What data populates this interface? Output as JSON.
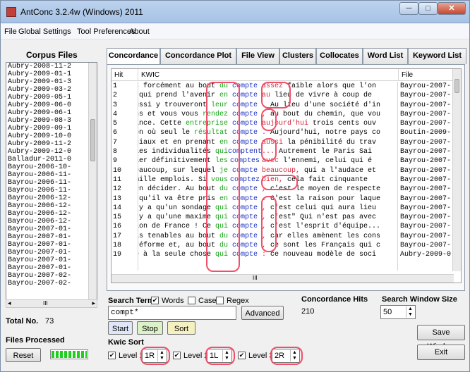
{
  "window": {
    "title": "AntConc 3.2.4w (Windows) 2011",
    "minimize": "─",
    "maximize": "□",
    "close": "✕"
  },
  "menu": [
    "File",
    "Global Settings",
    "Tool Preferences",
    "About"
  ],
  "sidebar": {
    "title": "Corpus Files",
    "files": [
      "Aubry-2008-11-2",
      "Aubry-2009-01-1",
      "Aubry-2009-01-3",
      "Aubry-2009-03-2",
      "Aubry-2009-05-1",
      "Aubry-2009-06-0",
      "Aubry-2009-06-1",
      "Aubry-2009-08-3",
      "Aubry-2009-09-1",
      "Aubry-2009-10-0",
      "Aubry-2009-11-2",
      "Aubry-2009-12-0",
      "Balladur-2011-0",
      "Bayrou-2006-10-",
      "Bayrou-2006-11-",
      "Bayrou-2006-11-",
      "Bayrou-2006-11-",
      "Bayrou-2006-12-",
      "Bayrou-2006-12-",
      "Bayrou-2006-12-",
      "Bayrou-2006-12-",
      "Bayrou-2007-01-",
      "Bayrou-2007-01-",
      "Bayrou-2007-01-",
      "Bayrou-2007-01-",
      "Bayrou-2007-01-",
      "Bayrou-2007-01-",
      "Bayrou-2007-02-",
      "Bayrou-2007-02-"
    ],
    "scroll_left": "◂",
    "scroll_mid": "III",
    "scroll_right": "▸",
    "total_label": "Total No.",
    "total_value": "73",
    "processed_label": "Files Processed",
    "reset_label": "Reset",
    "progress": 1.0
  },
  "tabs": [
    "Concordance",
    "Concordance Plot",
    "File View",
    "Clusters",
    "Collocates",
    "Word List",
    "Keyword List"
  ],
  "concordance": {
    "headers": {
      "hit": "Hit",
      "kwic": "KWIC",
      "file": "File"
    },
    "rows": [
      {
        "hit": "1",
        "left": "eurs forcément au bout ",
        "leftc": "du",
        "leftcol": "green",
        "kw": "compte",
        "rw": "assez",
        "rwcol": "red",
        "rrest": " faible alors que l'on",
        "file": "Bayrou-2007-"
      },
      {
        "hit": "2",
        "left": "re, qui prend l'avenir ",
        "leftc": "en",
        "leftcol": "green",
        "kw": "compte",
        "rw": "au",
        "rwcol": "red",
        "rrest": " lieu de vivre à coup de",
        "file": "Bayrou-2007-"
      },
      {
        "hit": "3",
        "left": "s aussi y trouveront ",
        "leftc": "leur",
        "leftcol": "green",
        "kw": "compte",
        "rw": ".",
        "rwcol": "red",
        "rrest": " Au lieu d'une société d'in",
        "file": "Bayrou-2007-"
      },
      {
        "hit": "4",
        "left": "tions et vous vous ",
        "leftc": "rendez",
        "leftcol": "green",
        "kw": "compte",
        "rw": ",",
        "rwcol": "red",
        "rrest": " au bout du chemin, que vou",
        "file": "Bayrou-2007-"
      },
      {
        "hit": "5",
        "left": " France. Cette ",
        "leftc": "entreprise",
        "leftcol": "green",
        "kw": "compte",
        "rw": "aujourd'hui",
        "rwcol": "red",
        "rrest": " trois cents ouv",
        "file": "Bayrou-2007-"
      },
      {
        "hit": "6",
        "left": "ition où seul le ",
        "leftc": "résultat",
        "leftcol": "green",
        "kw": "compte",
        "rw": ".",
        "rwcol": "red",
        "rrest": " Aujourd'hui, notre pays co",
        "file": "Boutin-2009-"
      },
      {
        "hit": "7",
        "left": "spéciaux et en prenant ",
        "leftc": "en",
        "leftcol": "green",
        "kw": "compte",
        "rw": "aussi",
        "rwcol": "red",
        "rrest": " la pénibilité du trav",
        "file": "Bayrou-2007-"
      },
      {
        "hit": "8",
        "left": "as les individualités ",
        "leftc": "qui",
        "leftcol": "green",
        "kw": "comptent",
        "rw": "...",
        "rwcol": "red",
        "rrest": " Autrement le Paris Sai",
        "file": "Bayrou-2007-"
      },
      {
        "hit": "9",
        "left": "régler définitivement ",
        "leftc": "les",
        "leftcol": "green",
        "kw": "comptes",
        "rw": "avec",
        "rwcol": "red",
        "rrest": " l'ennemi, celui qui é",
        "file": "Bayrou-2007-"
      },
      {
        "hit": "10",
        "left": "e beaucoup, sur lequel ",
        "leftc": "je",
        "leftcol": "green",
        "kw": "compte",
        "rw": "beaucoup,",
        "rwcol": "red",
        "rrest": " qui a l'audace et",
        "file": "Bayrou-2007-"
      },
      {
        "hit": "11",
        "left": "ts mille emplois. Si ",
        "leftc": "vous",
        "leftcol": "green",
        "kw": "comptez",
        "rw": "bien,",
        "rwcol": "red",
        "rrest": " cela fait cinquante",
        "file": "Bayrou-2007-"
      },
      {
        "hit": "12",
        "left": "nt en décider. Au bout ",
        "leftc": "du",
        "leftcol": "green",
        "kw": "compte",
        "rw": ",",
        "rwcol": "red",
        "rrest": " c'est le moyen de respecte",
        "file": "Bayrou-2007-"
      },
      {
        "hit": "13",
        "left": "ude qu'il va être pris ",
        "leftc": "en",
        "leftcol": "green",
        "kw": "compte",
        "rw": ".",
        "rwcol": "red",
        "rrest": " C'est la raison pour laque",
        "file": "Bayrou-2007-"
      },
      {
        "hit": "14",
        "left": "l n'y a qu'un sondage ",
        "leftc": "qui",
        "leftcol": "green",
        "kw": "compte",
        "rw": ",",
        "rwcol": "red",
        "rrest": " c'est celui qui aura lieu",
        "file": "Bayrou-2007-"
      },
      {
        "hit": "15",
        "left": "l n'y a qu'une maxime ",
        "leftc": "qui",
        "leftcol": "green",
        "kw": "compte",
        "rw": ",",
        "rwcol": "red",
        "rrest": " c'est\" Qui n'est pas avec",
        "file": "Bayrou-2007-"
      },
      {
        "hit": "16",
        "left": "ampion de France ! Ce ",
        "leftc": "qui",
        "leftcol": "green",
        "kw": "compte",
        "rw": ",",
        "rwcol": "red",
        "rrest": " c'est l'esprit d'équipe...",
        "file": "Bayrou-2007-"
      },
      {
        "hit": "17",
        "left": "t pas tenables au bout ",
        "leftc": "du",
        "leftcol": "green",
        "kw": "compte",
        "rw": ",",
        "rwcol": "red",
        "rrest": " car elles amènent les cons",
        "file": "Bayrou-2007-"
      },
      {
        "hit": "18",
        "left": "te réforme et, au bout ",
        "leftc": "du",
        "leftcol": "green",
        "kw": "compte",
        "rw": ",",
        "rwcol": "red",
        "rrest": " ce sont les Français qui c",
        "file": "Bayrou-2007-"
      },
      {
        "hit": "19",
        "left": "mble à la seule chose ",
        "leftc": "qui",
        "leftcol": "green",
        "kw": "compte",
        "rw": ":",
        "rwcol": "red",
        "rrest": " ce nouveau modèle de soci",
        "file": "Aubry-2009-0"
      }
    ],
    "hscroll_mid": "III"
  },
  "search": {
    "term_label": "Search Term",
    "words_label": "Words",
    "words_checked": true,
    "case_label": "Case",
    "case_checked": false,
    "regex_label": "Regex",
    "regex_checked": false,
    "value": "compt*",
    "advanced_label": "Advanced",
    "start_label": "Start",
    "stop_label": "Stop",
    "sort_label": "Sort"
  },
  "hits": {
    "label": "Concordance Hits",
    "value": "210"
  },
  "window_size": {
    "label": "Search Window Size",
    "value": "50"
  },
  "buttons": {
    "save_window": "Save Window",
    "exit": "Exit"
  },
  "kwic_sort": {
    "label": "Kwic Sort",
    "levels": [
      {
        "label": "Level 1",
        "value": "1R",
        "checked": true
      },
      {
        "label": "Level 2",
        "value": "1L",
        "checked": true
      },
      {
        "label": "Level 3",
        "value": "2R",
        "checked": true
      }
    ]
  },
  "colors": {
    "green": "#19a319",
    "red": "#d2283c",
    "keyword": "#1b30c0",
    "annotation": "#f0506a"
  }
}
